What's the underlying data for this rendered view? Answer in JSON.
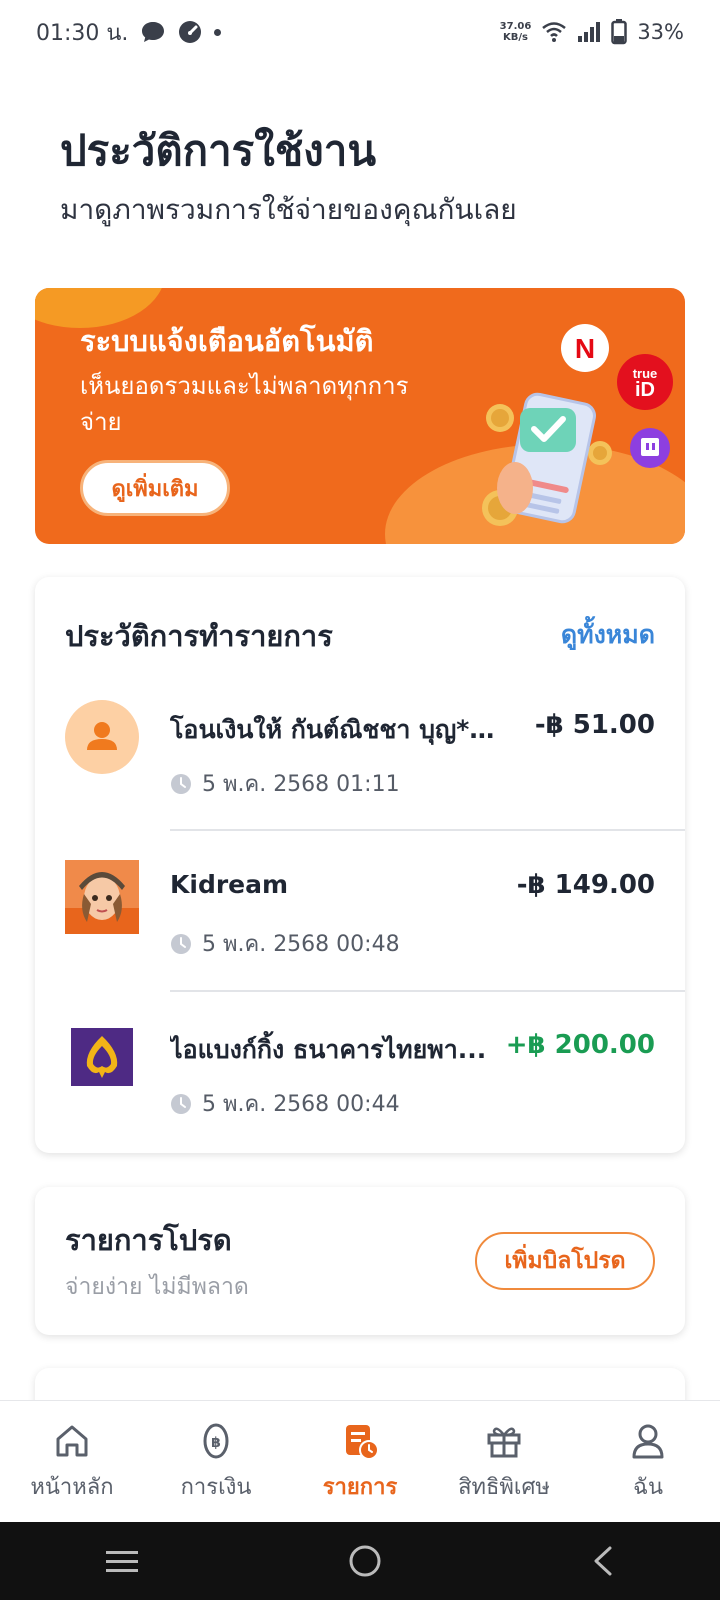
{
  "status_bar": {
    "time": "01:30 น.",
    "net_speed_value": "37.06",
    "net_speed_unit": "KB/s",
    "battery": "33%"
  },
  "header": {
    "title": "ประวัติการใช้งาน",
    "subtitle": "มาดูภาพรวมการใช้จ่ายของคุณกันเลย"
  },
  "banner": {
    "title": "ระบบแจ้งเตือนอัตโนมัติ",
    "text": "เห็นยอดรวมและไม่พลาดทุกการจ่าย",
    "button_label": "ดูเพิ่มเติม",
    "badges": [
      "N",
      "true iD",
      "twitch"
    ]
  },
  "history": {
    "title": "ประวัติการทำรายการ",
    "see_all_label": "ดูทั้งหมด",
    "items": [
      {
        "name": "โอนเงินให้  กันต์ณิชชา บุญ***",
        "amount": "-฿ 51.00",
        "time": "5 พ.ค. 2568 01:11",
        "icon": "person-icon"
      },
      {
        "name": "Kidream",
        "amount": "-฿ 149.00",
        "time": "5 พ.ค. 2568 00:48",
        "icon": "kidream-avatar"
      },
      {
        "name": "ไอแบงก์กิ้ง  ธนาคารไทยพา...",
        "amount": "+฿ 200.00",
        "time": "5 พ.ค. 2568 00:44",
        "icon": "scb-bank-logo"
      }
    ]
  },
  "favorite_bills": {
    "title": "รายการโปรด",
    "subtitle": "จ่ายง่าย ไม่มีพลาด",
    "button_label": "เพิ่มบิลโปรด"
  },
  "bottom_nav": [
    {
      "label": "หน้าหลัก",
      "icon": "home-icon"
    },
    {
      "label": "การเงิน",
      "icon": "baht-coin-icon"
    },
    {
      "label": "รายการ",
      "icon": "transactions-icon",
      "active": true
    },
    {
      "label": "สิทธิพิเศษ",
      "icon": "gift-icon"
    },
    {
      "label": "ฉัน",
      "icon": "profile-icon"
    }
  ],
  "colors": {
    "accent": "#e8651c",
    "banner": "#f06a1c",
    "positive": "#1a9c53",
    "link": "#3a86d8"
  }
}
